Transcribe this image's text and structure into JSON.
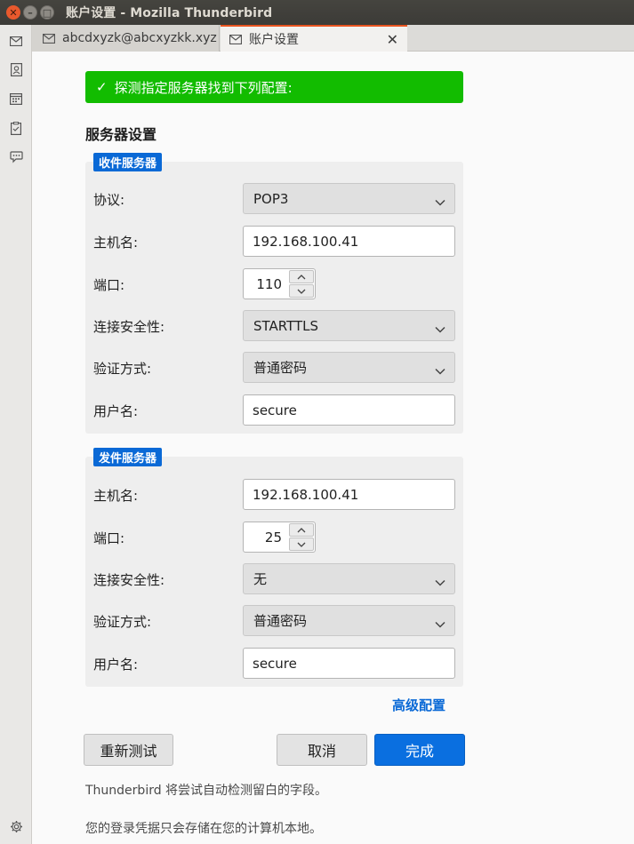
{
  "window": {
    "title": "账户设置 - Mozilla Thunderbird"
  },
  "tabs": [
    {
      "label": "abcdxyzk@abcxyzkk.xyz",
      "icon": "mail-icon",
      "active": false
    },
    {
      "label": "账户设置",
      "icon": "mail-icon",
      "active": true,
      "close_glyph": "✕"
    }
  ],
  "spaces": [
    "mail-icon",
    "address-book-icon",
    "calendar-icon",
    "tasks-icon",
    "chat-icon",
    "settings-icon"
  ],
  "banner": {
    "check": "✓",
    "text": "探测指定服务器找到下列配置:",
    "color": "#12bc00"
  },
  "section_title": "服务器设置",
  "incoming": {
    "badge": "收件服务器",
    "protocol_label": "协议:",
    "protocol": "POP3",
    "hostname_label": "主机名:",
    "hostname": "192.168.100.41",
    "port_label": "端口:",
    "port": "110",
    "security_label": "连接安全性:",
    "security": "STARTTLS",
    "auth_label": "验证方式:",
    "auth": "普通密码",
    "username_label": "用户名:",
    "username": "secure"
  },
  "outgoing": {
    "badge": "发件服务器",
    "hostname_label": "主机名:",
    "hostname": "192.168.100.41",
    "port_label": "端口:",
    "port": "25",
    "security_label": "连接安全性:",
    "security": "无",
    "auth_label": "验证方式:",
    "auth": "普通密码",
    "username_label": "用户名:",
    "username": "secure"
  },
  "advanced_link": "高级配置",
  "buttons": {
    "retest": "重新测试",
    "cancel": "取消",
    "done": "完成"
  },
  "notes": {
    "autodetect": "Thunderbird 将尝试自动检测留白的字段。",
    "credentials": "您的登录凭据只会存储在您的计算机本地。"
  },
  "colors": {
    "accent": "#0a69d6",
    "success": "#12bc00",
    "primary_button": "#0a6fe0"
  }
}
